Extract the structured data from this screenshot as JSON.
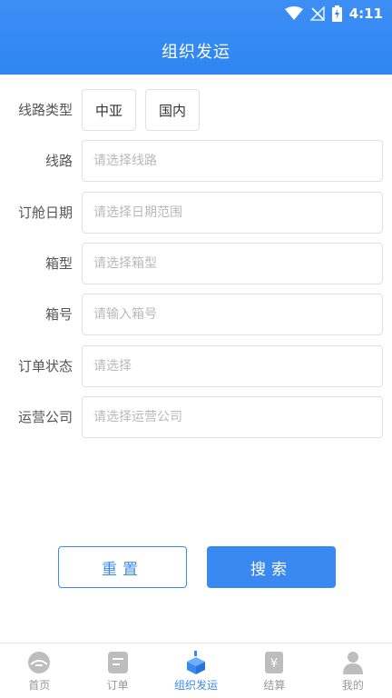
{
  "status_bar": {
    "time": "4:11"
  },
  "header": {
    "title": "组织发运"
  },
  "form": {
    "route_type": {
      "label": "线路类型",
      "options": [
        "中亚",
        "国内"
      ]
    },
    "route": {
      "label": "线路",
      "placeholder": "请选择线路"
    },
    "booking_date": {
      "label": "订舱日期",
      "placeholder": "请选择日期范围"
    },
    "container_type": {
      "label": "箱型",
      "placeholder": "请选择箱型"
    },
    "container_no": {
      "label": "箱号",
      "placeholder": "请输入箱号"
    },
    "order_status": {
      "label": "订单状态",
      "placeholder": "请选择"
    },
    "carrier": {
      "label": "运营公司",
      "placeholder": "请选择运营公司"
    }
  },
  "actions": {
    "reset": "重置",
    "search": "搜索"
  },
  "tabbar": {
    "active_index": 2,
    "items": [
      {
        "label": "首页",
        "icon": "home-icon"
      },
      {
        "label": "订单",
        "icon": "order-icon"
      },
      {
        "label": "组织发运",
        "icon": "shipping-icon"
      },
      {
        "label": "结算",
        "icon": "settlement-icon"
      },
      {
        "label": "我的",
        "icon": "profile-icon"
      }
    ]
  },
  "colors": {
    "primary": "#3a89f0",
    "inactive": "#999999"
  }
}
